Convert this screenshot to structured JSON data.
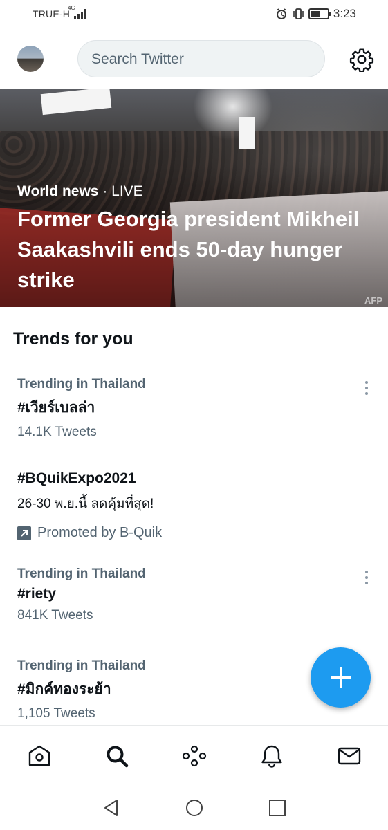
{
  "status_bar": {
    "carrier": "TRUE-H",
    "network": "4G",
    "time": "3:23",
    "battery_level": 0.6
  },
  "header": {
    "search_placeholder": "Search Twitter"
  },
  "hero": {
    "category": "World news",
    "live_label": "· LIVE",
    "title": "Former Georgia president Mikheil Saakashvili ends 50-day hunger strike",
    "photo_credit": "AFP"
  },
  "trends": {
    "heading": "Trends for you",
    "items": [
      {
        "context": "Trending in Thailand",
        "name": "#เวียร์เบลล่า",
        "count": "14.1K Tweets"
      },
      {
        "name": "#BQuikExpo2021",
        "description": "26-30 พ.ย.นี้ ลดคุ้มที่สุด!",
        "promoted": "Promoted by B-Quik"
      },
      {
        "context": "Trending in Thailand",
        "name": "#riety",
        "count": "841K Tweets"
      },
      {
        "context": "Trending in Thailand",
        "name": "#มิกค์ทองระย้า",
        "count": "1,105 Tweets"
      }
    ]
  },
  "colors": {
    "accent": "#1d9bf0",
    "secondary_text": "#536471",
    "primary_text": "#0f1419"
  },
  "bottom_nav": {
    "items": [
      "home-icon",
      "search-icon",
      "spaces-icon",
      "notifications-icon",
      "messages-icon"
    ],
    "active": "search-icon"
  }
}
